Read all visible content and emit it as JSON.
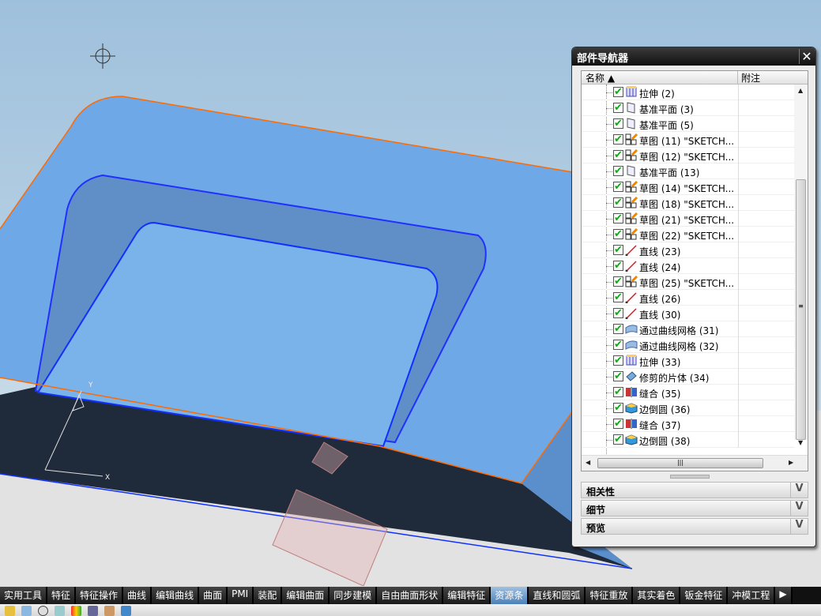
{
  "navigator": {
    "title": "部件导航器",
    "columns": {
      "name": "名称",
      "note": "附注"
    },
    "rows": [
      {
        "label": "拉伸 (2)",
        "icon": "extrude-icon"
      },
      {
        "label": "基准平面 (3)",
        "icon": "datum-plane-icon"
      },
      {
        "label": "基准平面 (5)",
        "icon": "datum-plane-icon"
      },
      {
        "label": "草图 (11) \"SKETCH...",
        "icon": "sketch-icon"
      },
      {
        "label": "草图 (12) \"SKETCH...",
        "icon": "sketch-icon"
      },
      {
        "label": "基准平面 (13)",
        "icon": "datum-plane-icon"
      },
      {
        "label": "草图 (14) \"SKETCH...",
        "icon": "sketch-icon"
      },
      {
        "label": "草图 (18) \"SKETCH...",
        "icon": "sketch-icon"
      },
      {
        "label": "草图 (21) \"SKETCH...",
        "icon": "sketch-icon"
      },
      {
        "label": "草图 (22) \"SKETCH...",
        "icon": "sketch-icon"
      },
      {
        "label": "直线 (23)",
        "icon": "line-icon"
      },
      {
        "label": "直线 (24)",
        "icon": "line-icon"
      },
      {
        "label": "草图 (25) \"SKETCH...",
        "icon": "sketch-icon"
      },
      {
        "label": "直线 (26)",
        "icon": "line-icon"
      },
      {
        "label": "直线 (30)",
        "icon": "line-icon"
      },
      {
        "label": "通过曲线网格 (31)",
        "icon": "mesh-surface-icon"
      },
      {
        "label": "通过曲线网格 (32)",
        "icon": "mesh-surface-icon"
      },
      {
        "label": "拉伸 (33)",
        "icon": "extrude-icon"
      },
      {
        "label": "修剪的片体 (34)",
        "icon": "trimmed-sheet-icon"
      },
      {
        "label": "缝合 (35)",
        "icon": "sew-icon"
      },
      {
        "label": "边倒圆 (36)",
        "icon": "edge-blend-icon"
      },
      {
        "label": "缝合 (37)",
        "icon": "sew-icon"
      },
      {
        "label": "边倒圆 (38)",
        "icon": "edge-blend-icon"
      }
    ],
    "sections": [
      "相关性",
      "细节",
      "预览"
    ]
  },
  "axes": {
    "x": "X",
    "y": "Y"
  },
  "tabs": [
    "实用工具",
    "特征",
    "特征操作",
    "曲线",
    "编辑曲线",
    "曲面",
    "PMI",
    "装配",
    "编辑曲面",
    "同步建模",
    "自由曲面形状",
    "编辑特征",
    "资源条",
    "直线和圆弧",
    "特征重放",
    "其实着色",
    "钣金特征",
    "冲模工程"
  ],
  "active_tab": "资源条",
  "colors": {
    "model": "#6fa8e0",
    "edge": "#ff6a00",
    "selected_edge": "#1030ff",
    "tab_bar": "#1a1a1a"
  }
}
